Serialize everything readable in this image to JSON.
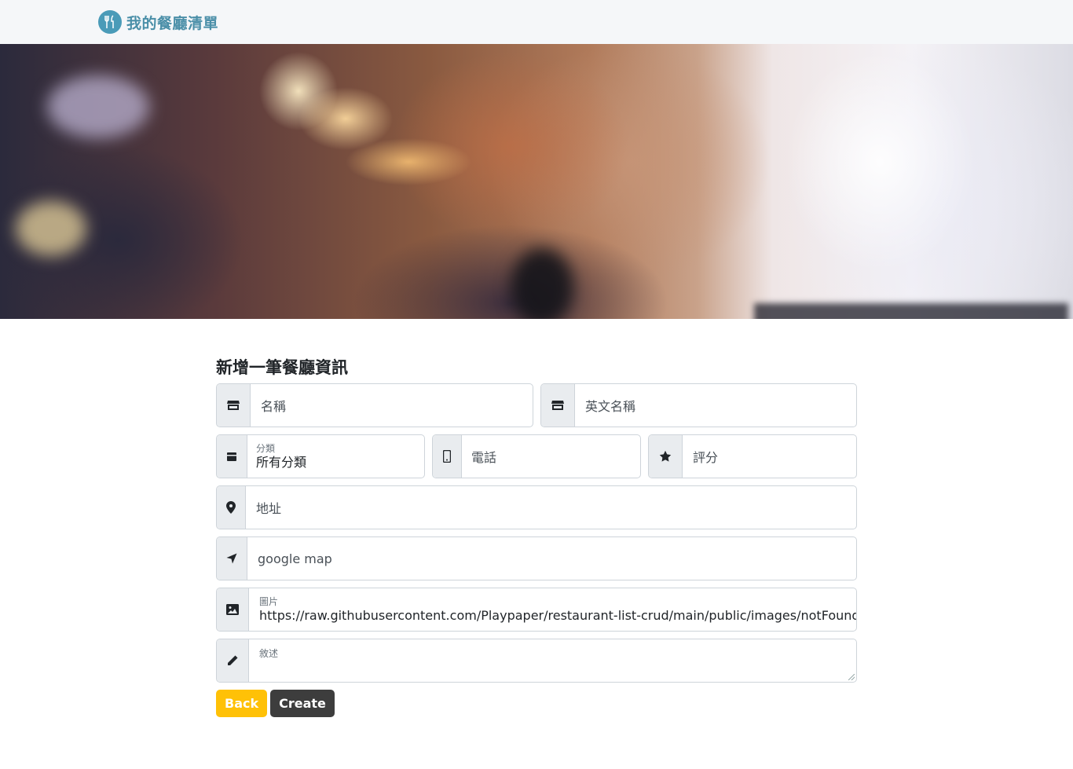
{
  "brand": {
    "title": "我的餐廳清單",
    "icon": "utensils-icon",
    "color": "#4a9bb8"
  },
  "form": {
    "heading": "新增一筆餐廳資訊",
    "name_placeholder": "名稱",
    "name_en_placeholder": "英文名稱",
    "category_label": "分類",
    "category_value": "所有分類",
    "phone_placeholder": "電話",
    "rating_placeholder": "評分",
    "address_placeholder": "地址",
    "map_placeholder": "google map",
    "image_label": "圖片",
    "image_value": "https://raw.githubusercontent.com/Playpaper/restaurant-list-crud/main/public/images/notFound.png",
    "description_label": "敘述"
  },
  "buttons": {
    "back": "Back",
    "create": "Create"
  },
  "colors": {
    "back": "#ffc107",
    "create": "#3d3d3d"
  }
}
